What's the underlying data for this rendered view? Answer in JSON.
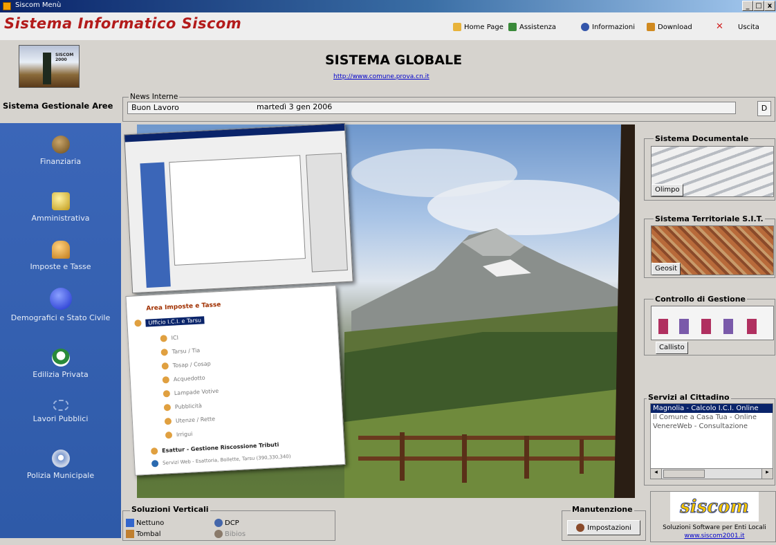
{
  "window": {
    "title": "Siscom Menù",
    "controls": [
      "_",
      "□",
      "x"
    ]
  },
  "app": {
    "title": "Sistema Informatico Siscom"
  },
  "toplinks": [
    {
      "label": "Home Page",
      "icon": "home-icon",
      "color": "#e8b33a"
    },
    {
      "label": "Assistenza",
      "icon": "assistance-icon",
      "color": "#3a8a3a"
    },
    {
      "label": "Informazioni",
      "icon": "info-icon",
      "color": "#3355aa"
    },
    {
      "label": "Download",
      "icon": "download-icon",
      "color": "#d08a20"
    },
    {
      "label": "Uscita",
      "icon": "exit-icon",
      "color": "#d02020"
    }
  ],
  "header": {
    "logo_text": "SISCOM 2000",
    "system_title": "SISTEMA GLOBALE",
    "url": "http://www.comune.prova.cn.it"
  },
  "sidebar": {
    "header": "Sistema Gestionale Aree",
    "items": [
      {
        "label": "Finanziaria",
        "icon": "finance-icon",
        "color": "#8a6a2a"
      },
      {
        "label": "Amministrativa",
        "icon": "admin-icon",
        "color": "#e9c53a"
      },
      {
        "label": "Imposte e Tasse",
        "icon": "taxes-icon",
        "color": "#e8a23a"
      },
      {
        "label": "Demografici e Stato Civile",
        "icon": "demographic-icon",
        "color": "#3355ee"
      },
      {
        "label": "Edilizia Privata",
        "icon": "building-icon",
        "color": "#2a8a3a"
      },
      {
        "label": "Lavori Pubblici",
        "icon": "public-works-icon",
        "color": "#7a9acc"
      },
      {
        "label": "Polizia Municipale",
        "icon": "police-icon",
        "color": "#c9d3e6"
      }
    ]
  },
  "news": {
    "legend": "News Interne",
    "text": "Buon Lavoro",
    "date": "martedì 3 gen 2006",
    "button": "D"
  },
  "overlay_tree": {
    "title": "Area Imposte e Tasse",
    "selected": "Ufficio I.C.I. e Tarsu",
    "items": [
      "ICI",
      "Tarsu / Tia",
      "Tosap / Cosap",
      "Acquedotto",
      "Lampade Votive",
      "Pubblicità",
      "Utenze / Rette",
      "Irrigui"
    ],
    "bottom_items": [
      "Esattur - Gestione Riscossione Tributi",
      "Servizi Web - Esattoria, Bollette, Tarsu (390,330,340)"
    ]
  },
  "right_panels": {
    "documentale": {
      "legend": "Sistema Documentale",
      "button": "Olimpo"
    },
    "territoriale": {
      "legend": "Sistema Territoriale S.I.T.",
      "button": "Geosit"
    },
    "controllo": {
      "legend": "Controllo di Gestione",
      "button": "Callisto"
    },
    "servizi": {
      "legend": "Servizi al Cittadino",
      "items": [
        "Magnolia - Calcolo I.C.I. Online",
        "Il Comune a Casa Tua - Online",
        "VenereWeb - Consultazione"
      ],
      "scroll_left": "◂",
      "scroll_right": "▸"
    }
  },
  "bottom": {
    "verticali": {
      "legend": "Soluzioni Verticali",
      "items": [
        {
          "label": "Nettuno",
          "icon": "nettuno-icon",
          "color": "#3366cc"
        },
        {
          "label": "Tombal",
          "icon": "tombal-icon",
          "color": "#c08030"
        },
        {
          "label": "DCP",
          "icon": "dcp-icon",
          "color": "#4466aa"
        },
        {
          "label": "Bibios",
          "icon": "bibios-icon",
          "color": "#8a7a6a"
        }
      ]
    },
    "manutenzione": {
      "legend": "Manutenzione",
      "button": "Impostazioni"
    },
    "siscom": {
      "logo": "siscom",
      "tagline": "Soluzioni Software per Enti Locali",
      "url": "www.siscom2001.it"
    }
  }
}
